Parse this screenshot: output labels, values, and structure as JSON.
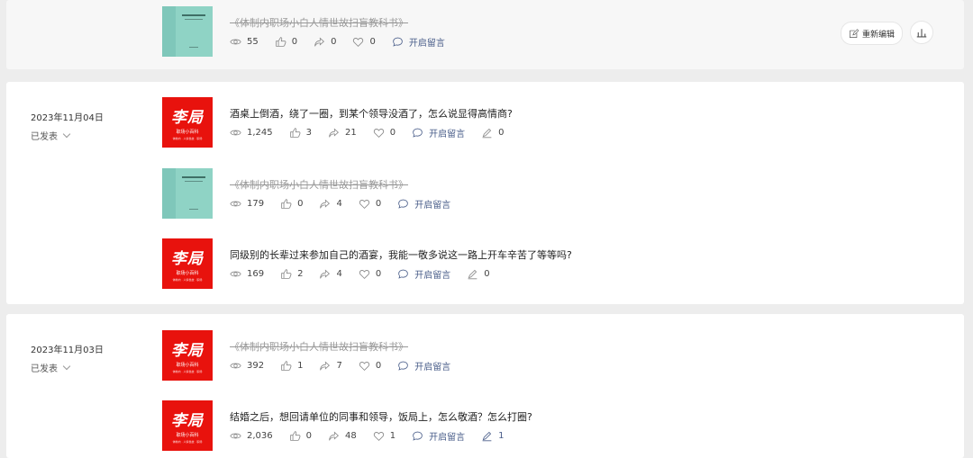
{
  "groups": [
    {
      "date": "",
      "status": "",
      "posts": [
        {
          "thumb": "book",
          "title": "《体制内职场小白人情世故扫盲教科书》",
          "deleted": true,
          "views": "55",
          "likes": "0",
          "shares": "0",
          "favs": "0",
          "comment": "开启留言",
          "edits": null
        }
      ],
      "actions": {
        "edit_label": "重新编辑",
        "edit_icon": "edit-icon",
        "stats_icon": "bar-chart-icon"
      }
    },
    {
      "date": "2023年11月04日",
      "status": "已发表",
      "posts": [
        {
          "thumb": "red",
          "title": "酒桌上倒酒，绕了一圈，到某个领导没酒了，怎么说显得高情商?",
          "deleted": false,
          "views": "1,245",
          "likes": "3",
          "shares": "21",
          "favs": "0",
          "comment": "开启留言",
          "edits": "0"
        },
        {
          "thumb": "book",
          "title": "《体制内职场小白人情世故扫盲教科书》",
          "deleted": true,
          "views": "179",
          "likes": "0",
          "shares": "4",
          "favs": "0",
          "comment": "开启留言",
          "edits": null
        },
        {
          "thumb": "red",
          "title": "同级别的长辈过来参加自己的酒宴，我能一敬多说这一路上开车辛苦了等等吗?",
          "deleted": false,
          "views": "169",
          "likes": "2",
          "shares": "4",
          "favs": "0",
          "comment": "开启留言",
          "edits": "0"
        }
      ]
    },
    {
      "date": "2023年11月03日",
      "status": "已发表",
      "posts": [
        {
          "thumb": "red",
          "title": "《体制内职场小白人情世故扫盲教科书》",
          "deleted": true,
          "views": "392",
          "likes": "1",
          "shares": "7",
          "favs": "0",
          "comment": "开启留言",
          "edits": null
        },
        {
          "thumb": "red",
          "title": "结婚之后，想回请单位的同事和领导，饭局上，怎么敬酒？怎么打圈?",
          "deleted": false,
          "views": "2,036",
          "likes": "0",
          "shares": "48",
          "favs": "1",
          "comment": "开启留言",
          "edits": "1"
        }
      ]
    }
  ],
  "thumb_red": {
    "logo": "李局",
    "sub": "职场小百科",
    "sub2": "体制内 · 人情世故 · 职场"
  },
  "colors": {
    "accent": "#4a5e8a",
    "thumb_red": "#e8120d",
    "thumb_book": "#7fc7ba",
    "background": "#ededed"
  }
}
